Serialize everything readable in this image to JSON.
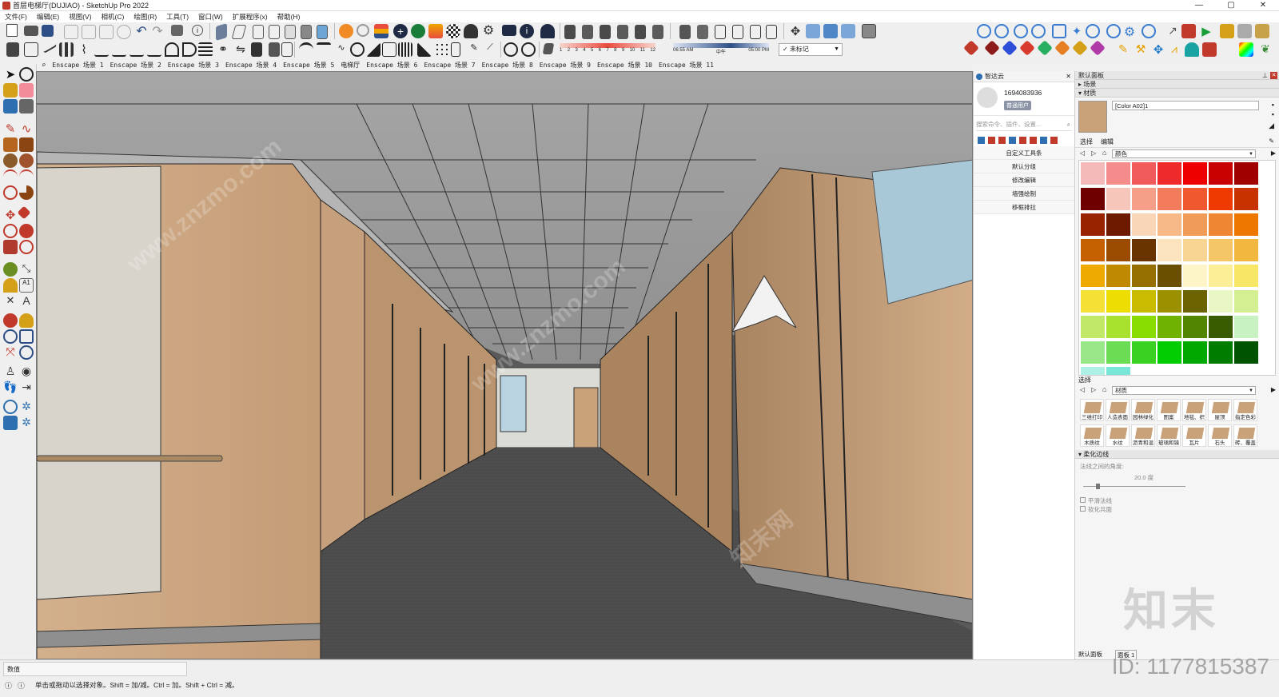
{
  "window": {
    "title": "首层电梯厅(DUJIAO) - SketchUp Pro 2022",
    "controls": [
      "—",
      "▢",
      "✕"
    ]
  },
  "menu": [
    "文件(F)",
    "编辑(E)",
    "视图(V)",
    "相机(C)",
    "绘图(R)",
    "工具(T)",
    "窗口(W)",
    "扩展程序(x)",
    "帮助(H)"
  ],
  "shadow": {
    "months": [
      "1",
      "2",
      "3",
      "4",
      "5",
      "6",
      "7",
      "8",
      "9",
      "10",
      "11",
      "12"
    ],
    "time_start": "06:55 AM",
    "time_mid": "中午",
    "time_end": "05:00 PM"
  },
  "tag_select": {
    "value": "未标记"
  },
  "scenes": [
    "Enscape 场景 1",
    "Enscape 场景 2",
    "Enscape 场景 3",
    "Enscape 场景 4",
    "Enscape 场景 5",
    "电梯厅",
    "Enscape 场景 6",
    "Enscape 场景 7",
    "Enscape 场景 8",
    "Enscape 场景 9",
    "Enscape 场景 10",
    "Enscape 场景 11"
  ],
  "zhidayun": {
    "title": "智达云",
    "user_id": "1694083936",
    "user_badge": "普通用户",
    "search_placeholder": "搜索命令、插件、设置...",
    "menu": [
      "自定义工具条",
      "默认分组",
      "修改编辑",
      "墙强绘制",
      "移框排拉"
    ]
  },
  "tray": {
    "title": "默认面板",
    "scenes_label": "场景",
    "materials_label": "材质",
    "material_name": "[Color A02]1",
    "tab_select": "选择",
    "tab_edit": "编辑",
    "color_dropdown": "颜色",
    "select2": "选择",
    "materials_dropdown": "材质",
    "material_items": [
      "三维打印",
      "人造表面",
      "园林绿化",
      "图案",
      "地毯、织",
      "屋顶",
      "指定色彩",
      "木质纹",
      "水纹",
      "沥青和混",
      "玻璃和镜",
      "瓦片",
      "石头",
      "砖、覆盖"
    ],
    "soften_label": "柔化边线",
    "angle_label": "法线之间的角度:",
    "angle_value": "20.0 度",
    "smooth_normals": "平滑法线",
    "soften_coplanar": "软化共面",
    "bottom_tabs": [
      "默认面板",
      "面板 1"
    ]
  },
  "swatch_colors": [
    "#f4b9b9",
    "#f48c8c",
    "#f05a5a",
    "#ee2a2a",
    "#ee0000",
    "#c80000",
    "#a00000",
    "#6e0000",
    "#f6c6bb",
    "#f59e88",
    "#f27b5c",
    "#f0582f",
    "#ee3a00",
    "#c83200",
    "#982300",
    "#6e1a00",
    "#fad6b8",
    "#f6b987",
    "#f19b58",
    "#ef8634",
    "#ee7700",
    "#c46000",
    "#9a4b00",
    "#6a3400",
    "#fbe3bd",
    "#f8d492",
    "#f4c668",
    "#f2b73e",
    "#eeaa00",
    "#c08a00",
    "#957000",
    "#6a4f00",
    "#fdf5c7",
    "#fbee96",
    "#f8e766",
    "#f5e035",
    "#eedd00",
    "#c8bb00",
    "#9b9100",
    "#6b6300",
    "#e9f7c4",
    "#d4ef91",
    "#c1e866",
    "#a8e22f",
    "#88dc00",
    "#6fb300",
    "#528600",
    "#385b00",
    "#c8f2c1",
    "#9ae78a",
    "#6cdc55",
    "#3ad122",
    "#00cc00",
    "#00a800",
    "#007d00",
    "#005300",
    "#aef0e6",
    "#7ae6d8"
  ],
  "status": {
    "value_label": "数值",
    "hint": "单击或拖动以选择对象。Shift = 加/减。Ctrl = 加。Shift + Ctrl = 减。"
  },
  "watermark": {
    "brand": "知末",
    "id": "ID: 1177815387",
    "site": "www.znzmo.com",
    "site_cn": "知末网"
  },
  "colors": {
    "accent": "#c0392b",
    "wood": "#c9a27a",
    "floor": "#4b4b4b",
    "ceiling": "#9a9a9a"
  }
}
